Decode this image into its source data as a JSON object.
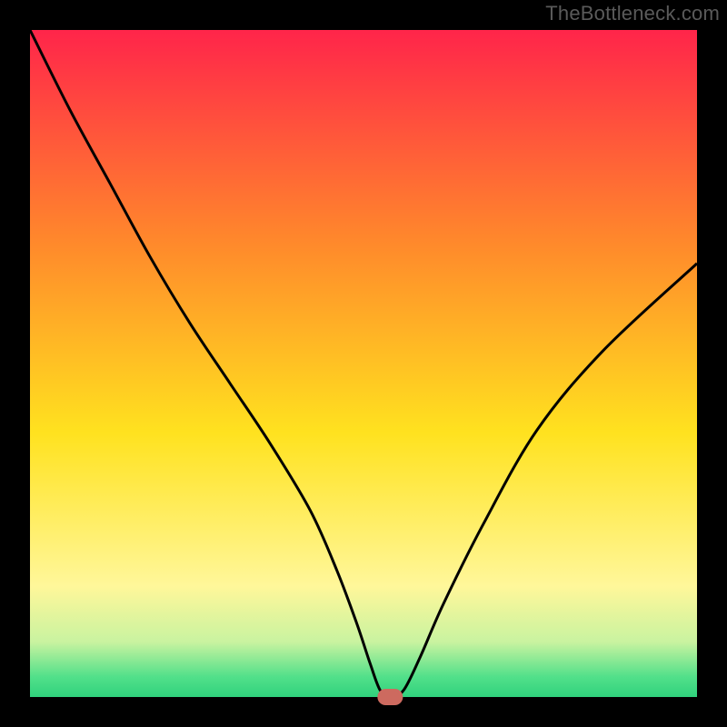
{
  "watermark": "TheBottleneck.com",
  "chart_data": {
    "type": "line",
    "title": "",
    "xlabel": "",
    "ylabel": "",
    "x_range": [
      0,
      100
    ],
    "y_range": [
      0,
      100
    ],
    "gradient_stops": [
      {
        "offset": 0,
        "color": "#ff1e4c"
      },
      {
        "offset": 33,
        "color": "#ff8a2b"
      },
      {
        "offset": 60,
        "color": "#ffe21f"
      },
      {
        "offset": 82,
        "color": "#fff79a"
      },
      {
        "offset": 90,
        "color": "#c9f3a0"
      },
      {
        "offset": 95,
        "color": "#52e08a"
      },
      {
        "offset": 100,
        "color": "#18c873"
      }
    ],
    "series": [
      {
        "name": "bottleneck-curve",
        "x": [
          0,
          6,
          12,
          18,
          24,
          30,
          36,
          42,
          46,
          49,
          51,
          52.5,
          54,
          56,
          58.5,
          62,
          68,
          76,
          86,
          100
        ],
        "y": [
          100,
          88,
          77,
          66,
          56,
          47,
          38,
          28,
          19,
          11,
          5,
          1,
          0,
          1,
          6,
          14,
          26,
          40,
          52,
          65
        ]
      }
    ],
    "marker": {
      "x": 54,
      "y": 0,
      "label": ""
    },
    "grid": false,
    "legend": false
  }
}
